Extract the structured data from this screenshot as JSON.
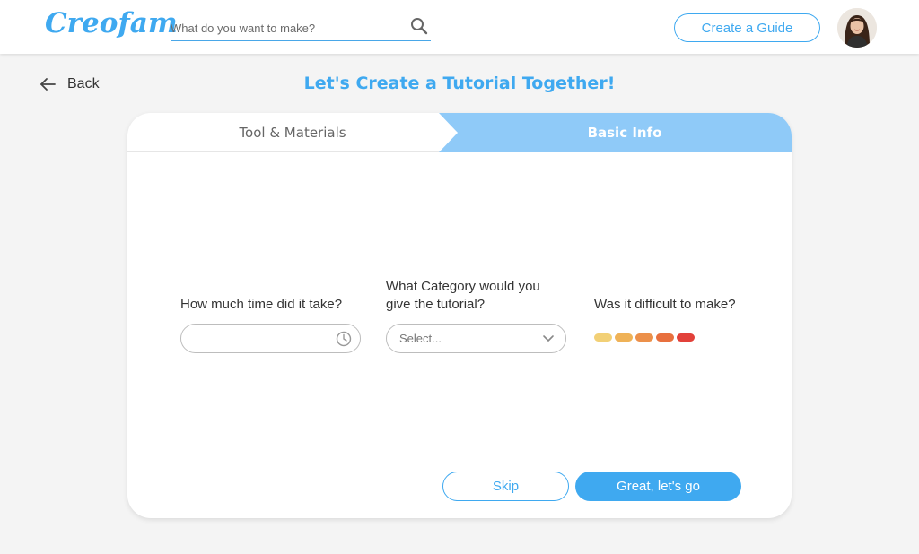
{
  "header": {
    "logo_text": "Creofam",
    "search": {
      "placeholder": "What do you want to make?",
      "value": ""
    },
    "create_guide_label": "Create a Guide",
    "brand_color": "#3fa9f0"
  },
  "nav": {
    "back_label": "Back"
  },
  "page": {
    "title": "Let's Create a Tutorial Together!"
  },
  "steps": [
    {
      "label": "Tool & Materials",
      "active": false
    },
    {
      "label": "Basic Info",
      "active": true,
      "color": "#8fcaf8"
    }
  ],
  "form": {
    "time": {
      "label": "How much time did it take?",
      "value": "",
      "icon": "clock-icon"
    },
    "category": {
      "label": "What Category would you give the tutorial?",
      "selected": "Select...",
      "icon": "chevron-down-icon"
    },
    "difficulty": {
      "label": "Was it difficult to make?",
      "levels": [
        {
          "color": "#f9d67a"
        },
        {
          "color": "#f6b85a"
        },
        {
          "color": "#f3944c"
        },
        {
          "color": "#ef7340"
        },
        {
          "color": "#e9433c"
        }
      ]
    }
  },
  "actions": {
    "skip_label": "Skip",
    "go_label": "Great, let's go"
  }
}
